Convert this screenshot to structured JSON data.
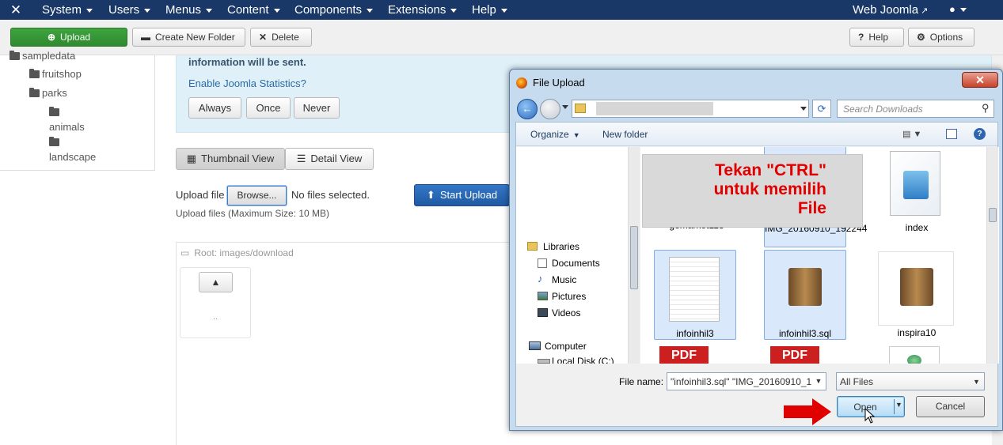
{
  "topnav": {
    "logo_glyph": "✕",
    "menus": [
      "System",
      "Users",
      "Menus",
      "Content",
      "Components",
      "Extensions",
      "Help"
    ],
    "site_link": "Web Joomla",
    "user_glyph": "👤"
  },
  "toolbar": {
    "upload_label": "Upload",
    "create_folder_label": "Create New Folder",
    "delete_label": "Delete",
    "help_label": "Help",
    "options_label": "Options"
  },
  "tree": {
    "items": [
      {
        "label": "sampledata"
      },
      {
        "label": "fruitshop"
      },
      {
        "label": "parks"
      },
      {
        "label": "animals"
      },
      {
        "label": "landscape"
      }
    ]
  },
  "stats": {
    "text": "information will be sent.",
    "link": "Enable Joomla Statistics?",
    "always_label": "Always",
    "once_label": "Once",
    "never_label": "Never"
  },
  "views": {
    "thumbnail_label": "Thumbnail View",
    "detail_label": "Detail View"
  },
  "upload": {
    "label": "Upload file",
    "browse_label": "Browse...",
    "no_file_text": "No files selected.",
    "start_label": "Start Upload",
    "max_size_text": "Upload files (Maximum Size: 10 MB)"
  },
  "browser": {
    "root_label": "Root: images/download",
    "up_label": ".."
  },
  "dialog": {
    "title": "File Upload",
    "close_label": "✕",
    "search_placeholder": "Search Downloads",
    "organize_label": "Organize",
    "new_folder_label": "New folder",
    "nav_items": [
      {
        "label": "Libraries"
      },
      {
        "label": "Documents"
      },
      {
        "label": "Music"
      },
      {
        "label": "Pictures"
      },
      {
        "label": "Videos"
      },
      {
        "label": "Computer"
      },
      {
        "label": "Local Disk (C:)"
      }
    ],
    "files": [
      {
        "name": "gomarket118"
      },
      {
        "name": "IMG_20160910_192244"
      },
      {
        "name": "index"
      },
      {
        "name": "infoinhil3"
      },
      {
        "name": "infoinhil3.sql"
      },
      {
        "name": "inspira10"
      },
      {
        "name": "PDF"
      },
      {
        "name": "PDF"
      }
    ],
    "annotation": "Tekan \"CTRL\" untuk memilih File",
    "filename_label": "File name:",
    "filename_value": "\"infoinhil3.sql\" \"IMG_20160910_19...",
    "filetype_value": "All Files",
    "open_label": "Open",
    "cancel_label": "Cancel"
  },
  "colors": {
    "nav_bg": "#1a3867",
    "upload_green": "#2f8a2f",
    "start_upload_blue": "#2a69b8",
    "info_bg": "#dff0f8",
    "annotation_text": "#e00000",
    "arrow_red": "#e00000"
  }
}
